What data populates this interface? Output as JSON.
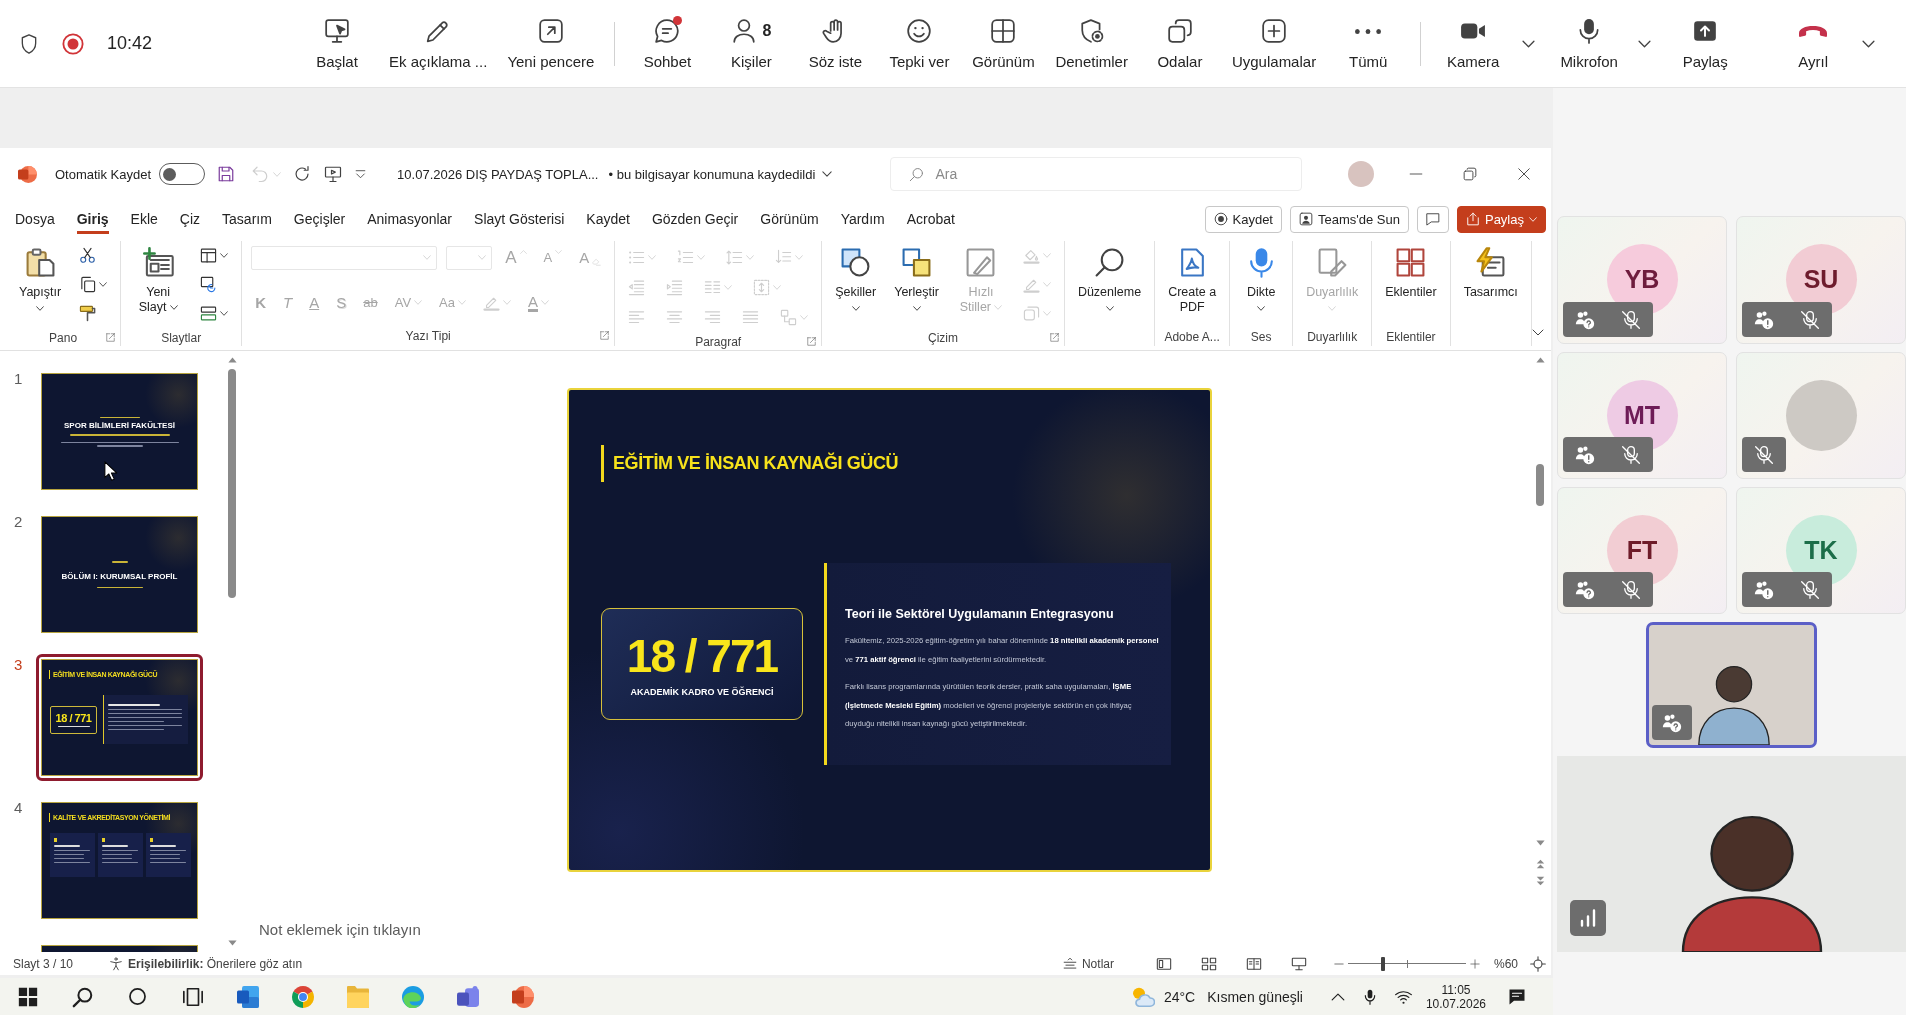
{
  "meeting_bar": {
    "recording": true,
    "time": "10:42",
    "action_groups": [
      {
        "actions": [
          {
            "kind": "share-tray",
            "label": "Başlat"
          },
          {
            "kind": "pen",
            "label": "Ek açıklama ..."
          },
          {
            "kind": "popout",
            "label": "Yeni pencere"
          }
        ]
      },
      {
        "actions": [
          {
            "kind": "chat",
            "label": "Sohbet",
            "unread": true
          },
          {
            "kind": "people",
            "label": "Kişiler",
            "count": "8"
          },
          {
            "kind": "hand",
            "label": "Söz iste"
          },
          {
            "kind": "smile",
            "label": "Tepki ver"
          },
          {
            "kind": "grid",
            "label": "Görünüm"
          },
          {
            "kind": "shield-gear",
            "label": "Denetimler"
          },
          {
            "kind": "rooms",
            "label": "Odalar"
          },
          {
            "kind": "plus",
            "label": "Uygulamalar"
          },
          {
            "kind": "more",
            "label": "Tümü"
          }
        ]
      },
      {
        "actions": [
          {
            "kind": "camera",
            "label": "Kamera",
            "on": true,
            "dropdown": true
          },
          {
            "kind": "mic",
            "label": "Mikrofon",
            "on": true,
            "dropdown": true
          },
          {
            "kind": "share",
            "label": "Paylaş"
          },
          {
            "kind": "leave",
            "label": "Ayrıl",
            "dropdown": true
          }
        ]
      }
    ]
  },
  "powerpoint": {
    "title_bar": {
      "autosave_label": "Otomatik Kaydet",
      "autosave_on": false,
      "undo_disabled": true,
      "file_name": "10.07.2026 DIŞ PAYDAŞ TOPLA...",
      "save_status": "• bu bilgisayar konumuna kaydedildi",
      "search_placeholder": "Ara"
    },
    "tabs": [
      {
        "label": "Dosya",
        "selected": false
      },
      {
        "label": "Giriş",
        "selected": true
      },
      {
        "label": "Ekle",
        "selected": false
      },
      {
        "label": "Çiz",
        "selected": false
      },
      {
        "label": "Tasarım",
        "selected": false
      },
      {
        "label": "Geçişler",
        "selected": false
      },
      {
        "label": "Animasyonlar",
        "selected": false
      },
      {
        "label": "Slayt Gösterisi",
        "selected": false
      },
      {
        "label": "Kaydet",
        "selected": false
      },
      {
        "label": "Gözden Geçir",
        "selected": false
      },
      {
        "label": "Görünüm",
        "selected": false
      },
      {
        "label": "Yardım",
        "selected": false
      },
      {
        "label": "Acrobat",
        "selected": false
      }
    ],
    "tab_actions": [
      {
        "kind": "record",
        "label": "Kaydet"
      },
      {
        "kind": "present-teams",
        "label": "Teams'de Sun"
      },
      {
        "kind": "comment"
      },
      {
        "kind": "share",
        "label": "Paylaş",
        "dropdown": true
      }
    ],
    "ribbon": {
      "groups": [
        {
          "label": "Pano",
          "launcher": true,
          "large": [
            {
              "kind": "paste",
              "label": "Yapıştır",
              "dropdown": true,
              "disabled": false
            }
          ],
          "small": [
            {
              "kind": "cut",
              "disabled": false
            },
            {
              "kind": "copy",
              "dropdown": true,
              "disabled": false
            },
            {
              "kind": "painter",
              "disabled": false
            }
          ]
        },
        {
          "label": "Slaytlar",
          "large": [
            {
              "kind": "new-slide",
              "label": "Yeni Slayt",
              "dropdown": true,
              "disabled": false
            }
          ],
          "small": [
            {
              "kind": "layout",
              "dropdown": true,
              "disabled": false
            },
            {
              "kind": "reset",
              "disabled": false
            },
            {
              "kind": "section",
              "dropdown": true,
              "disabled": false
            }
          ]
        },
        {
          "label": "Yazı Tipi",
          "launcher": true,
          "rows": [
            [
              {
                "kind": "font-field",
                "dropdown": true,
                "disabled": true
              },
              {
                "kind": "size-field",
                "dropdown": true,
                "disabled": true
              },
              {
                "kind": "grow",
                "label": "A",
                "disabled": true
              },
              {
                "kind": "shrink",
                "label": "A",
                "disabled": true
              },
              {
                "kind": "clear",
                "label": "A",
                "disabled": true
              }
            ],
            [
              {
                "kind": "bold",
                "label": "K",
                "disabled": true
              },
              {
                "kind": "italic",
                "label": "T",
                "disabled": true
              },
              {
                "kind": "underline",
                "label": "A",
                "disabled": true
              },
              {
                "kind": "shadow",
                "label": "S",
                "disabled": true
              },
              {
                "kind": "strike",
                "label": "ab",
                "disabled": true
              },
              {
                "kind": "spacing",
                "label": "AV",
                "dropdown": true,
                "disabled": true
              },
              {
                "kind": "case",
                "label": "Aa",
                "dropdown": true,
                "disabled": true
              },
              {
                "kind": "highlight",
                "dropdown": true,
                "disabled": true
              },
              {
                "kind": "font-color",
                "label": "A",
                "dropdown": true,
                "disabled": true
              }
            ]
          ]
        },
        {
          "label": "Paragraf",
          "launcher": true,
          "rows": [
            [
              {
                "kind": "bullets",
                "dropdown": true,
                "disabled": true
              },
              {
                "kind": "numbering",
                "dropdown": true,
                "disabled": true
              },
              {
                "kind": "line-spacing",
                "dropdown": true,
                "disabled": true
              },
              {
                "kind": "text-direction",
                "dropdown": true,
                "disabled": true
              }
            ],
            [
              {
                "kind": "outdent",
                "disabled": true
              },
              {
                "kind": "indent",
                "disabled": true
              },
              {
                "kind": "columns",
                "dropdown": true,
                "disabled": true
              },
              {
                "kind": "align-text",
                "dropdown": true,
                "disabled": true
              }
            ],
            [
              {
                "kind": "align-left",
                "disabled": true
              },
              {
                "kind": "center",
                "disabled": true
              },
              {
                "kind": "align-right",
                "disabled": true
              },
              {
                "kind": "justify",
                "disabled": true
              },
              {
                "kind": "smartart",
                "dropdown": true,
                "disabled": true
              }
            ]
          ]
        },
        {
          "label": "Çizim",
          "launcher": true,
          "large": [
            {
              "kind": "shapes",
              "label": "Şekiller",
              "dropdown": true,
              "disabled": false
            },
            {
              "kind": "arrange",
              "label": "Yerleştir",
              "dropdown": true,
              "disabled": false
            },
            {
              "kind": "quick-styles",
              "label": "Hızlı Stiller",
              "dropdown": true,
              "disabled": true
            }
          ],
          "small": [
            {
              "kind": "fill",
              "dropdown": true,
              "disabled": true
            },
            {
              "kind": "outline",
              "dropdown": true,
              "disabled": true
            },
            {
              "kind": "effects",
              "dropdown": true,
              "disabled": true
            }
          ]
        },
        {
          "large": [
            {
              "kind": "find",
              "label": "Düzenleme",
              "dropdown": true,
              "disabled": false
            }
          ]
        },
        {
          "label": "Adobe A...",
          "large": [
            {
              "kind": "pdf",
              "label": "Create a PDF",
              "disabled": false
            }
          ]
        },
        {
          "label": "Ses",
          "large": [
            {
              "kind": "dictate",
              "label": "Dikte",
              "dropdown": true,
              "disabled": false
            }
          ]
        },
        {
          "label": "Duyarlılık",
          "large": [
            {
              "kind": "sensitivity",
              "label": "Duyarlılık",
              "dropdown": true,
              "disabled": true
            }
          ]
        },
        {
          "label": "Eklentiler",
          "large": [
            {
              "kind": "addins",
              "label": "Eklentiler",
              "disabled": false
            }
          ]
        },
        {
          "large": [
            {
              "kind": "designer",
              "label": "Tasarımcı",
              "disabled": false
            }
          ]
        }
      ]
    },
    "thumbnails": [
      {
        "number": "1",
        "selected": false,
        "kind": "title",
        "title": "SPOR BİLİMLERİ FAKÜLTESİ"
      },
      {
        "number": "2",
        "selected": false,
        "kind": "section",
        "title": "BÖLÜM I: KURUMSAL PROFİL"
      },
      {
        "number": "3",
        "selected": true,
        "kind": "stat",
        "title": "EĞİTİM VE İNSAN KAYNAĞI GÜCÜ",
        "stat": "18 / 771"
      },
      {
        "number": "4",
        "selected": false,
        "kind": "cards",
        "title": "KALİTE VE AKREDİTASYON YÖNETİMİ"
      },
      {
        "selected": false,
        "kind": "blank"
      }
    ],
    "slide": {
      "title": "EĞİTİM VE İNSAN KAYNAĞI GÜCÜ",
      "stat_value": "18 / 771",
      "stat_label": "AKADEMİK KADRO VE ÖĞRENCİ",
      "panel_heading": "Teori ile Sektörel Uygulamanın Entegrasyonu",
      "paragraphs": [
        "Fakültemiz, 2025-2026 eğitim-öğretim yılı bahar döneminde **18 nitelikli akademik personel** ve **771 aktif öğrenci** ile eğitim faaliyetlerini sürdürmektedir.",
        "Farklı lisans programlarında yürütülen teorik dersler, pratik saha uygulamaları, **İŞME (İşletmede Mesleki Eğitim)** modelleri ve öğrenci projeleriyle sektörün en çok ihtiyaç duyduğu nitelikli insan kaynağı gücü yetiştirilmektedir."
      ]
    },
    "notes_placeholder": "Not eklemek için tıklayın",
    "status_bar": {
      "slide_counter": "Slayt 3 / 10",
      "accessibility": "**Erişilebilirlik:** Önerilere göz atın",
      "notes_label": "Notlar",
      "zoom_slider": {
        "level": 0.3
      },
      "zoom_text": "%60"
    }
  },
  "taskbar": {
    "weather": {
      "temperature": "24°C",
      "condition": "Kısmen güneşli"
    },
    "time": "11:05",
    "date": "10.07.2026"
  },
  "participants": [
    {
      "kind": "initials",
      "initials": "YB",
      "color": "#f6cbdc",
      "badge": {
        "kind": "question"
      },
      "muted": true,
      "speaking": false
    },
    {
      "kind": "initials",
      "initials": "SU",
      "color": "#f2ccd4",
      "badge": {
        "kind": "alert"
      },
      "muted": true,
      "speaking": false
    },
    {
      "kind": "initials",
      "initials": "MT",
      "color": "#eecbe4",
      "badge": {
        "kind": "alert"
      },
      "muted": true,
      "speaking": false
    },
    {
      "kind": "photo",
      "muted": true,
      "speaking": false
    },
    {
      "kind": "initials",
      "initials": "FT",
      "color": "#f2cdd3",
      "badge": {
        "kind": "question"
      },
      "muted": true,
      "speaking": false
    },
    {
      "kind": "initials",
      "initials": "TK",
      "color": "#c8ecdc",
      "badge": {
        "kind": "alert"
      },
      "muted": true,
      "speaking": false
    },
    {
      "kind": "video",
      "badge": {
        "kind": "question"
      },
      "muted": false,
      "speaking": true
    },
    {
      "kind": "video-wide",
      "muted": false,
      "speaking": false
    }
  ]
}
